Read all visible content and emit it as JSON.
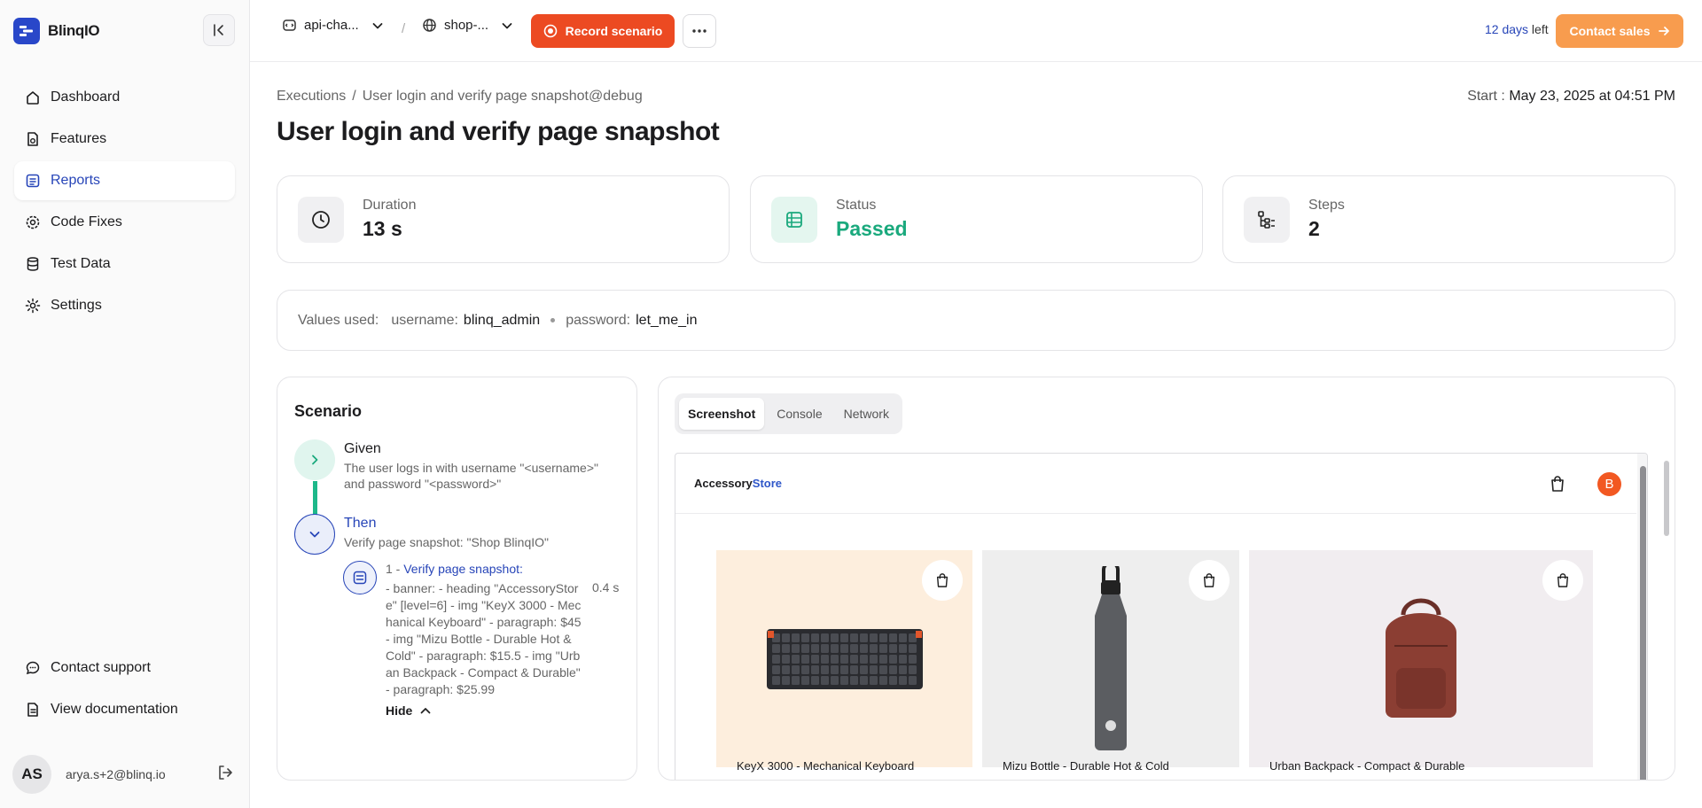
{
  "app": {
    "name": "BlinqIO"
  },
  "sidebar": {
    "items": [
      {
        "label": "Dashboard",
        "icon": "home-icon",
        "active": false
      },
      {
        "label": "Features",
        "icon": "feature-file-icon",
        "active": false
      },
      {
        "label": "Reports",
        "icon": "report-icon",
        "active": true
      },
      {
        "label": "Code Fixes",
        "icon": "code-fix-gear-icon",
        "active": false
      },
      {
        "label": "Test Data",
        "icon": "database-icon",
        "active": false
      },
      {
        "label": "Settings",
        "icon": "gear-icon",
        "active": false
      }
    ],
    "bottom": [
      {
        "label": "Contact support",
        "icon": "chat-bubble-icon"
      },
      {
        "label": "View documentation",
        "icon": "document-icon"
      }
    ],
    "user": {
      "initials": "AS",
      "email": "arya.s+2@blinq.io"
    }
  },
  "topbar": {
    "project": "api-cha...",
    "environment": "shop-...",
    "separator": "/",
    "record_label": "Record scenario",
    "trial_days": "12 days",
    "trial_suffix": " left",
    "contact_label": "Contact sales"
  },
  "page": {
    "breadcrumb": {
      "root": "Executions",
      "sep": "/",
      "current": "User login and verify page snapshot@debug"
    },
    "start_label": "Start :",
    "start_value": "May 23, 2025 at 04:51 PM",
    "title": "User login and verify page snapshot"
  },
  "stats": {
    "duration": {
      "label": "Duration",
      "value": "13 s"
    },
    "status": {
      "label": "Status",
      "value": "Passed",
      "color": "#1aa97d"
    },
    "steps": {
      "label": "Steps",
      "value": "2"
    }
  },
  "values_used": {
    "label": "Values used:",
    "username_label": "username:",
    "username": "blinq_admin",
    "password_label": "password:",
    "password": "let_me_in"
  },
  "scenario": {
    "title": "Scenario",
    "given": {
      "keyword": "Given",
      "text": "The user logs in with username \"<username>\" and password \"<password>\""
    },
    "then": {
      "keyword": "Then",
      "text": "Verify page snapshot: \"Shop BlinqIO\""
    },
    "substep": {
      "index": "1 - ",
      "title": "Verify page snapshot:",
      "time": "0.4 s",
      "detail": "- banner: - heading \"AccessoryStore\" [level=6] - img \"KeyX 3000 - Mechanical Keyboard\" - paragraph: $45 - img \"Mizu Bottle - Durable Hot & Cold\" - paragraph: $15.5 - img \"Urban Backpack - Compact & Durable\" - paragraph: $25.99"
    },
    "hide_label": "Hide"
  },
  "detail": {
    "tabs": [
      "Screenshot",
      "Console",
      "Network"
    ],
    "active_tab": "Screenshot",
    "preview": {
      "store_name_a": "Accessory",
      "store_name_b": "Store",
      "avatar": "B",
      "products": [
        {
          "name": "KeyX 3000 - Mechanical Keyboard",
          "bg": "#fdeedd"
        },
        {
          "name": "Mizu Bottle - Durable Hot & Cold",
          "bg": "#eeeeee"
        },
        {
          "name": "Urban Backpack - Compact & Durable",
          "bg": "#f1edf0"
        }
      ]
    }
  },
  "colors": {
    "accent": "#2745b8",
    "record": "#ec4a22",
    "contact": "#f89c4e",
    "passed": "#1aa97d"
  }
}
